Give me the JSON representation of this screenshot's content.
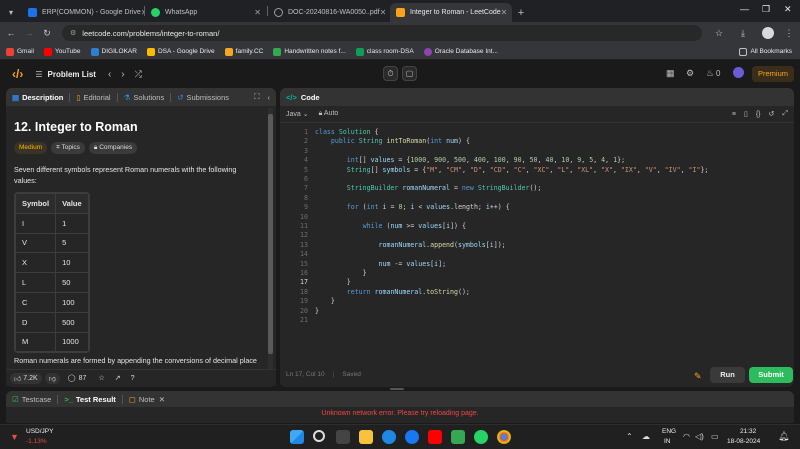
{
  "browser": {
    "tabs": [
      {
        "title": "ERP(COMMON) - Google Drive",
        "color": "#1a73e8",
        "active": false
      },
      {
        "title": "WhatsApp",
        "color": "#25d366",
        "active": false
      },
      {
        "title": "DOC-20240816-WA0050..pdf",
        "color": "#9aa0a6",
        "active": false
      },
      {
        "title": "Integer to Roman - LeetCode",
        "color": "#ffa116",
        "active": true
      }
    ],
    "new_tab": "+",
    "url": "leetcode.com/problems/integer-to-roman/",
    "bookmarks": [
      {
        "label": "Gmail",
        "color": "#ea4335"
      },
      {
        "label": "YouTube",
        "color": "#ff0000"
      },
      {
        "label": "DIGILOKAR",
        "color": "#2d7fd2"
      },
      {
        "label": "DSA - Google Drive",
        "color": "#fbbc04"
      },
      {
        "label": "family.CC",
        "color": "#f5a623"
      },
      {
        "label": "Handwritten notes f...",
        "color": "#34a853"
      },
      {
        "label": "class room-DSA",
        "color": "#0f9d58"
      },
      {
        "label": "Oracle Database Int...",
        "color": "#8e44ad"
      }
    ],
    "all_bookmarks": "All Bookmarks"
  },
  "leetcode": {
    "problem_list": "Problem List",
    "streak": "0",
    "premium": "Premium"
  },
  "left_panel": {
    "tabs": [
      "Description",
      "Editorial",
      "Solutions",
      "Submissions"
    ],
    "title": "12. Integer to Roman",
    "difficulty": "Medium",
    "topics": "Topics",
    "companies": "Companies",
    "description": "Seven different symbols represent Roman numerals with the following values:",
    "table_headers": [
      "Symbol",
      "Value"
    ],
    "table_rows": [
      [
        "I",
        "1"
      ],
      [
        "V",
        "5"
      ],
      [
        "X",
        "10"
      ],
      [
        "L",
        "50"
      ],
      [
        "C",
        "100"
      ],
      [
        "D",
        "500"
      ],
      [
        "M",
        "1000"
      ]
    ],
    "more_text": "Roman numerals are formed by appending the conversions of decimal place",
    "likes": "7.2K",
    "comments": "87"
  },
  "code_panel": {
    "title": "Code",
    "language": "Java",
    "autocomplete": "Auto",
    "status": "Ln 17, Col 10",
    "saved": "Saved",
    "run": "Run",
    "submit": "Submit"
  },
  "bottom_panel": {
    "testcase": "Testcase",
    "test_result": "Test Result",
    "note": "Note",
    "error": "Unknown network error. Please try reloading page."
  },
  "taskbar": {
    "ticker": "USD/JPY",
    "change": "-1.13%",
    "lang": "ENG",
    "region": "IN",
    "time": "21:32",
    "date": "18-08-2024"
  }
}
